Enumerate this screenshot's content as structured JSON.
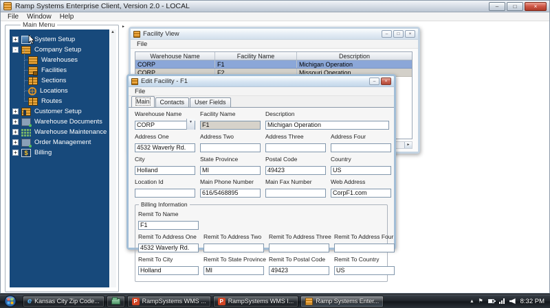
{
  "main_window": {
    "title": "Ramp Systems Enterprise Client, Version 2.0 - LOCAL",
    "menu_items": [
      "File",
      "Window",
      "Help"
    ]
  },
  "icons": {
    "minimize_glyph": "–",
    "maximize_glyph": "□",
    "close_glyph": "×",
    "dropdown_glyph": "▼",
    "scroll_up_glyph": "▲",
    "scroll_right_glyph": "►",
    "flag_glyph": "⚑",
    "tray_expand_glyph": "▴"
  },
  "colors": {
    "tree_background": "#17497B",
    "tree_icon_orange": "#DD9428",
    "selected_row_blue": "#8BA7D8",
    "app_icon_orange": "#E8952F"
  },
  "main_menu": {
    "panel_label": "Main Menu",
    "items": [
      {
        "label": "System Setup",
        "expander": "+",
        "icon": "system-setup-icon",
        "level": 0
      },
      {
        "label": "Company Setup",
        "expander": "-",
        "icon": "company-setup-icon",
        "level": 0
      },
      {
        "label": "Warehouses",
        "expander": "",
        "icon": "warehouses-icon",
        "level": 1
      },
      {
        "label": "Facilities",
        "expander": "",
        "icon": "facilities-icon",
        "level": 1
      },
      {
        "label": "Sections",
        "expander": "",
        "icon": "sections-icon",
        "level": 1
      },
      {
        "label": "Locations",
        "expander": "",
        "icon": "locations-icon",
        "level": 1
      },
      {
        "label": "Routes",
        "expander": "",
        "icon": "routes-icon",
        "level": 1
      },
      {
        "label": "Customer Setup",
        "expander": "+",
        "icon": "customer-setup-icon",
        "level": 0
      },
      {
        "label": "Warehouse Documents",
        "expander": "+",
        "icon": "warehouse-documents-icon",
        "level": 0
      },
      {
        "label": "Warehouse Maintenance",
        "expander": "+",
        "icon": "warehouse-maintenance-icon",
        "level": 0
      },
      {
        "label": "Order Management",
        "expander": "+",
        "icon": "order-management-icon",
        "level": 0
      },
      {
        "label": "Billing",
        "expander": "+",
        "icon": "billing-icon",
        "level": 0,
        "glyph": "$"
      }
    ]
  },
  "facility_view": {
    "title": "Facility View",
    "menu_items": [
      "File"
    ],
    "table": {
      "columns": [
        "Warehouse Name",
        "Facility Name",
        "Description"
      ],
      "rows": [
        {
          "warehouse_name": "CORP",
          "facility_name": "F1",
          "description": "Michigan Operation",
          "selected": true
        },
        {
          "warehouse_name": "CORP",
          "facility_name": "F2",
          "description": "Missouri Operation",
          "selected": false
        }
      ]
    }
  },
  "edit_facility": {
    "title": "Edit Facility - F1",
    "menu_items": [
      "File"
    ],
    "tabs": [
      "Main",
      "Contacts",
      "User Fields"
    ],
    "active_tab": "Main",
    "fields": [
      {
        "label": "Warehouse Name",
        "value": "CORP",
        "control": "combo"
      },
      {
        "label": "Facility Name",
        "value": "F1",
        "control": "disabled"
      },
      {
        "label": "Description",
        "value": "Michigan Operation",
        "control": "text"
      },
      {
        "label": "Address One",
        "value": "4532 Waverly Rd.",
        "control": "text"
      },
      {
        "label": "Address Two",
        "value": "",
        "control": "text"
      },
      {
        "label": "Address Three",
        "value": "",
        "control": "text"
      },
      {
        "label": "Address Four",
        "value": "",
        "control": "text"
      },
      {
        "label": "City",
        "value": "Holland",
        "control": "text"
      },
      {
        "label": "State Province",
        "value": "MI",
        "control": "text"
      },
      {
        "label": "Postal Code",
        "value": "49423",
        "control": "text"
      },
      {
        "label": "Country",
        "value": "US",
        "control": "text"
      },
      {
        "label": "Location Id",
        "value": "",
        "control": "text"
      },
      {
        "label": "Main Phone Number",
        "value": "616/5468895",
        "control": "text"
      },
      {
        "label": "Main Fax Number",
        "value": "",
        "control": "text"
      },
      {
        "label": "Web Address",
        "value": "CorpF1.com",
        "control": "text"
      }
    ],
    "billing": {
      "label": "Billing Information",
      "fields": [
        {
          "label": "Remit To Name",
          "value": "F1"
        },
        {
          "label": "Remit To Address One",
          "value": "4532 Waverly Rd."
        },
        {
          "label": "Remit To Address Two",
          "value": ""
        },
        {
          "label": "Remit To Address Three",
          "value": ""
        },
        {
          "label": "Remit To Address Four",
          "value": ""
        },
        {
          "label": "Remit To City",
          "value": "Holland"
        },
        {
          "label": "Remit To State Province",
          "value": "MI"
        },
        {
          "label": "Remit To Postal Code",
          "value": "49423"
        },
        {
          "label": "Remit To Country",
          "value": "US"
        }
      ]
    }
  },
  "taskbar": {
    "buttons": [
      {
        "label": "Kansas City Zip Code...",
        "icon": "internet-explorer-icon",
        "badge": "e"
      },
      {
        "label": "",
        "icon": "explorer-folder-icon",
        "badge": ""
      },
      {
        "label": "RampSystems WMS ...",
        "icon": "powerpoint-icon",
        "badge": "P"
      },
      {
        "label": "RampSystems WMS I...",
        "icon": "powerpoint-icon",
        "badge": "P"
      },
      {
        "label": "Ramp Systems Enter...",
        "icon": "ramp-app-icon",
        "badge": "",
        "active": true
      }
    ],
    "tray": {
      "time": "8:32 PM"
    }
  }
}
